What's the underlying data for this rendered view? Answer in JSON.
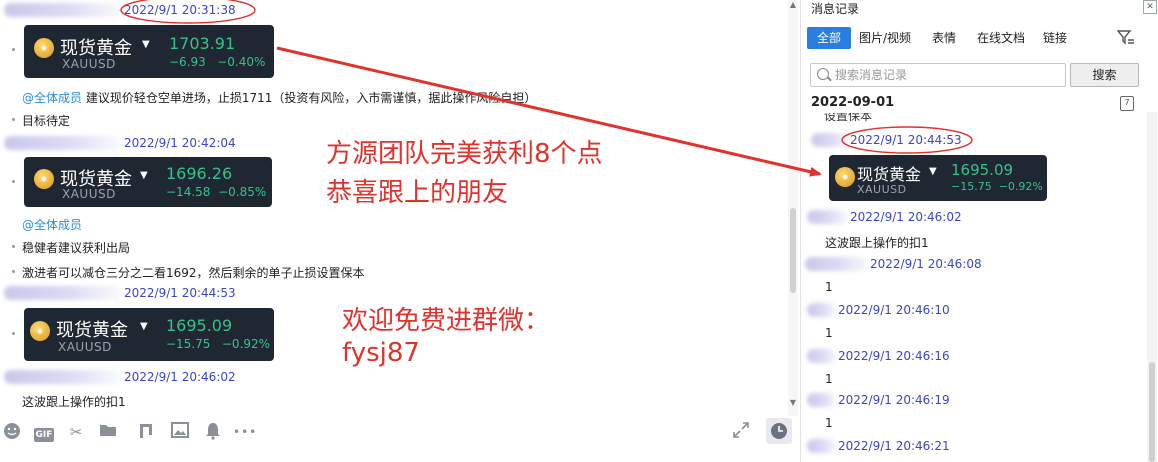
{
  "chat": {
    "timestamps": [
      "2022/9/1 20:31:38",
      "2022/9/1 20:42:04",
      "2022/9/1 20:44:53",
      "2022/9/1 20:46:02"
    ],
    "quote_cards": [
      {
        "name": "现货黄金",
        "symbol": "XAUUSD",
        "price": "1703.91",
        "change": "−6.93",
        "change_pct": "−0.40%"
      },
      {
        "name": "现货黄金",
        "symbol": "XAUUSD",
        "price": "1696.26",
        "change": "−14.58",
        "change_pct": "−0.85%"
      },
      {
        "name": "现货黄金",
        "symbol": "XAUUSD",
        "price": "1695.09",
        "change": "−15.75",
        "change_pct": "−0.92%"
      }
    ],
    "msg1_mention": "@全体成员",
    "msg1_text": "建议现价轻仓空单进场，止损1711（投资有风险，入市需谨慎，据此操作风险自担）",
    "msg2": "目标待定",
    "msg3_mention": "@全体成员",
    "msg4": "稳健者建议获利出局",
    "msg5": "激进者可以减仓三分之二看1692，然后剩余的单子止损设置保本",
    "msg6": "这波跟上操作的扣1",
    "overlay_line1": "方源团队完美获利8个点",
    "overlay_line2": "恭喜跟上的朋友",
    "overlay_line3": "欢迎免费进群微：",
    "overlay_line4": "fysj87",
    "accent_red": "#e2322c",
    "accent_blue": "#3a46c8"
  },
  "toolbar": {
    "icons": [
      "emoji-icon",
      "gif-icon",
      "scissors-icon",
      "folder-icon",
      "music-icon",
      "image-icon",
      "bell-icon",
      "more-icon",
      "expand-icon",
      "history-clock-icon"
    ],
    "gif_label": "GIF",
    "more_label": "•••"
  },
  "history": {
    "title": "消息记录",
    "tabs": [
      "全部",
      "图片/视频",
      "表情",
      "在线文档",
      "链接"
    ],
    "search_placeholder": "搜索消息记录",
    "search_button": "搜索",
    "date": "2022-09-01",
    "partial_text": "设置保本",
    "card": {
      "name": "现货黄金",
      "symbol": "XAUUSD",
      "price": "1695.09",
      "change": "−15.75",
      "change_pct": "−0.92%"
    },
    "entries": [
      {
        "time": "2022/9/1 20:44:53",
        "text": ""
      },
      {
        "time": "2022/9/1 20:46:02",
        "text": "这波跟上操作的扣1"
      },
      {
        "time": "2022/9/1 20:46:08",
        "text": "1"
      },
      {
        "time": "2022/9/1 20:46:10",
        "text": "1"
      },
      {
        "time": "2022/9/1 20:46:16",
        "text": "1"
      },
      {
        "time": "2022/9/1 20:46:19",
        "text": "1"
      },
      {
        "time": "2022/9/1 20:46:21",
        "text": ""
      }
    ]
  }
}
